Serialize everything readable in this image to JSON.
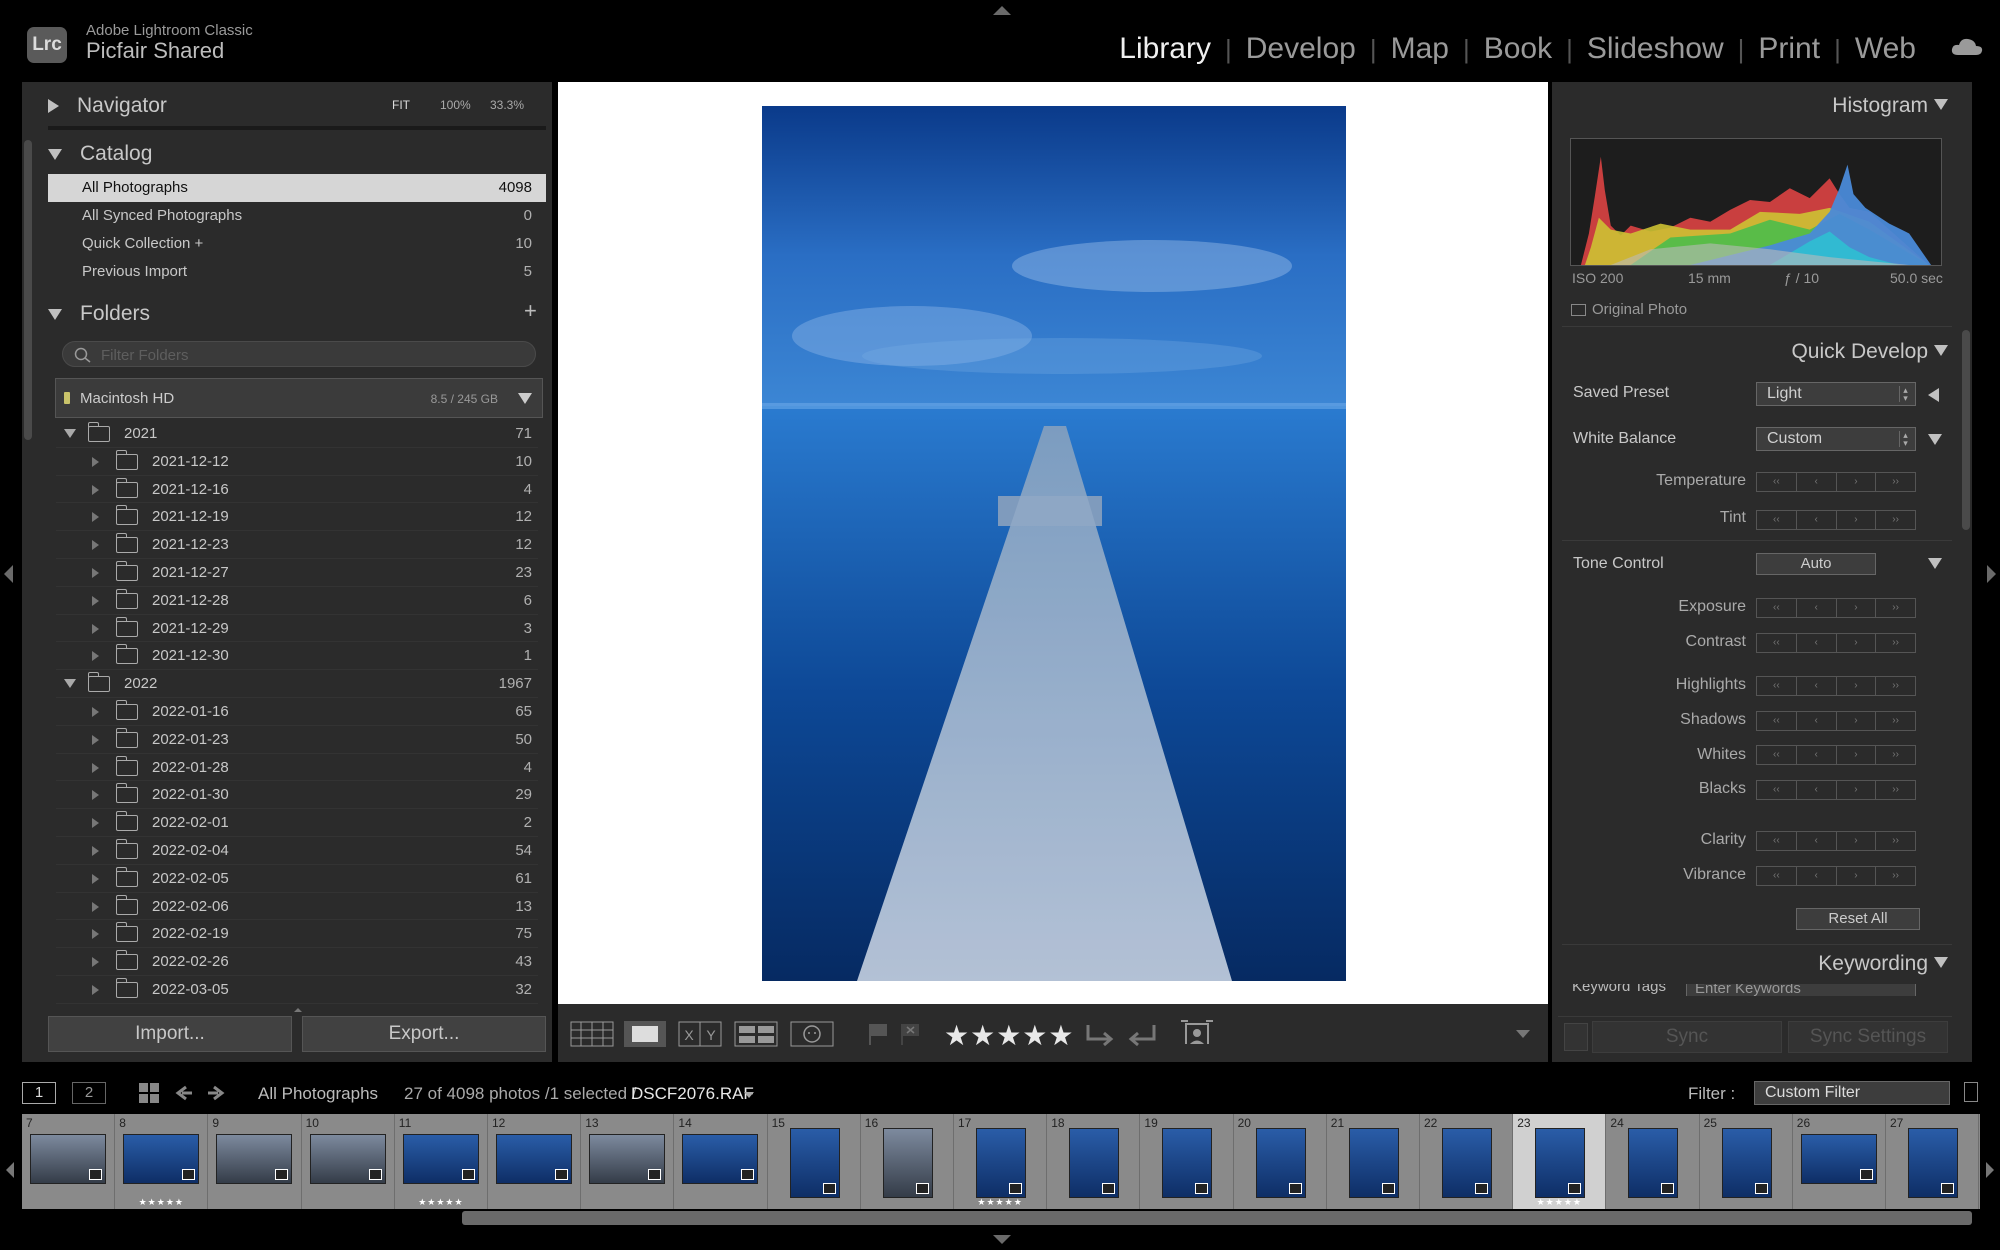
{
  "app": {
    "logo": "Lrc",
    "name": "Adobe Lightroom Classic",
    "catalog": "Picfair Shared"
  },
  "modules": [
    {
      "label": "Library",
      "active": true
    },
    {
      "label": "Develop",
      "active": false
    },
    {
      "label": "Map",
      "active": false
    },
    {
      "label": "Book",
      "active": false
    },
    {
      "label": "Slideshow",
      "active": false
    },
    {
      "label": "Print",
      "active": false
    },
    {
      "label": "Web",
      "active": false
    }
  ],
  "navigator": {
    "title": "Navigator",
    "fit": "FIT",
    "z100": "100%",
    "z333": "33.3%"
  },
  "catalog": {
    "title": "Catalog",
    "items": [
      {
        "label": "All Photographs",
        "count": "4098",
        "selected": true
      },
      {
        "label": "All Synced Photographs",
        "count": "0"
      },
      {
        "label": "Quick Collection  +",
        "count": "10"
      },
      {
        "label": "Previous Import",
        "count": "5"
      }
    ]
  },
  "folders": {
    "title": "Folders",
    "add": "+",
    "filter_placeholder": "Filter Folders",
    "volume": {
      "label": "Macintosh HD",
      "size": "8.5 / 245 GB"
    },
    "tree": [
      {
        "label": "2021",
        "count": "71",
        "level": 0
      },
      {
        "label": "2021-12-12",
        "count": "10",
        "level": 1
      },
      {
        "label": "2021-12-16",
        "count": "4",
        "level": 1
      },
      {
        "label": "2021-12-19",
        "count": "12",
        "level": 1
      },
      {
        "label": "2021-12-23",
        "count": "12",
        "level": 1
      },
      {
        "label": "2021-12-27",
        "count": "23",
        "level": 1
      },
      {
        "label": "2021-12-28",
        "count": "6",
        "level": 1
      },
      {
        "label": "2021-12-29",
        "count": "3",
        "level": 1
      },
      {
        "label": "2021-12-30",
        "count": "1",
        "level": 1
      },
      {
        "label": "2022",
        "count": "1967",
        "level": 0
      },
      {
        "label": "2022-01-16",
        "count": "65",
        "level": 1
      },
      {
        "label": "2022-01-23",
        "count": "50",
        "level": 1
      },
      {
        "label": "2022-01-28",
        "count": "4",
        "level": 1
      },
      {
        "label": "2022-01-30",
        "count": "29",
        "level": 1
      },
      {
        "label": "2022-02-01",
        "count": "2",
        "level": 1
      },
      {
        "label": "2022-02-04",
        "count": "54",
        "level": 1
      },
      {
        "label": "2022-02-05",
        "count": "61",
        "level": 1
      },
      {
        "label": "2022-02-06",
        "count": "13",
        "level": 1
      },
      {
        "label": "2022-02-19",
        "count": "75",
        "level": 1
      },
      {
        "label": "2022-02-26",
        "count": "43",
        "level": 1
      },
      {
        "label": "2022-03-05",
        "count": "32",
        "level": 1
      }
    ]
  },
  "buttons": {
    "import": "Import...",
    "export": "Export..."
  },
  "histogram": {
    "title": "Histogram",
    "iso": "ISO 200",
    "focal": "15 mm",
    "aperture": "ƒ / 10",
    "shutter": "50.0 sec",
    "original": "Original Photo"
  },
  "quick_develop": {
    "title": "Quick Develop",
    "saved_preset_label": "Saved Preset",
    "saved_preset_value": "Light",
    "wb_label": "White Balance",
    "wb_value": "Custom",
    "temperature": "Temperature",
    "tint": "Tint",
    "tone_label": "Tone Control",
    "auto": "Auto",
    "exposure": "Exposure",
    "contrast": "Contrast",
    "highlights": "Highlights",
    "shadows": "Shadows",
    "whites": "Whites",
    "blacks": "Blacks",
    "clarity": "Clarity",
    "vibrance": "Vibrance",
    "reset": "Reset All"
  },
  "keywording": {
    "title": "Keywording",
    "tags_label": "Keyword Tags",
    "tags_placeholder": "Enter Keywords"
  },
  "sync": {
    "sync": "Sync",
    "sync_settings": "Sync Settings"
  },
  "toolbar": {
    "rating_stars": "★★★★★"
  },
  "filmbar": {
    "screen1": "1",
    "screen2": "2",
    "source": "All Photographs",
    "count_text": "27 of 4098 photos /1 selected /",
    "filename": "DSCF2076.RAF",
    "filter_label": "Filter :",
    "filter_value": "Custom Filter"
  },
  "filmstrip": [
    {
      "n": "7",
      "stars": "",
      "gray": true
    },
    {
      "n": "8",
      "stars": "★★★★★",
      "gray": false
    },
    {
      "n": "9",
      "stars": "",
      "gray": true
    },
    {
      "n": "10",
      "stars": "",
      "gray": true
    },
    {
      "n": "11",
      "stars": "★★★★★",
      "gray": false
    },
    {
      "n": "12",
      "stars": "",
      "gray": false
    },
    {
      "n": "13",
      "stars": "",
      "gray": true
    },
    {
      "n": "14",
      "stars": "",
      "gray": false
    },
    {
      "n": "15",
      "stars": "",
      "gray": false
    },
    {
      "n": "16",
      "stars": "",
      "gray": true
    },
    {
      "n": "17",
      "stars": "★★★★★",
      "gray": false
    },
    {
      "n": "18",
      "stars": "",
      "gray": false
    },
    {
      "n": "19",
      "stars": "",
      "gray": false
    },
    {
      "n": "20",
      "stars": "",
      "gray": false
    },
    {
      "n": "21",
      "stars": "",
      "gray": false
    },
    {
      "n": "22",
      "stars": "",
      "gray": false
    },
    {
      "n": "23",
      "stars": "★★★★★",
      "gray": false,
      "selected": true
    },
    {
      "n": "24",
      "stars": "",
      "gray": false
    },
    {
      "n": "25",
      "stars": "",
      "gray": false
    },
    {
      "n": "26",
      "stars": "",
      "gray": false
    },
    {
      "n": "27",
      "stars": "",
      "gray": false
    }
  ]
}
